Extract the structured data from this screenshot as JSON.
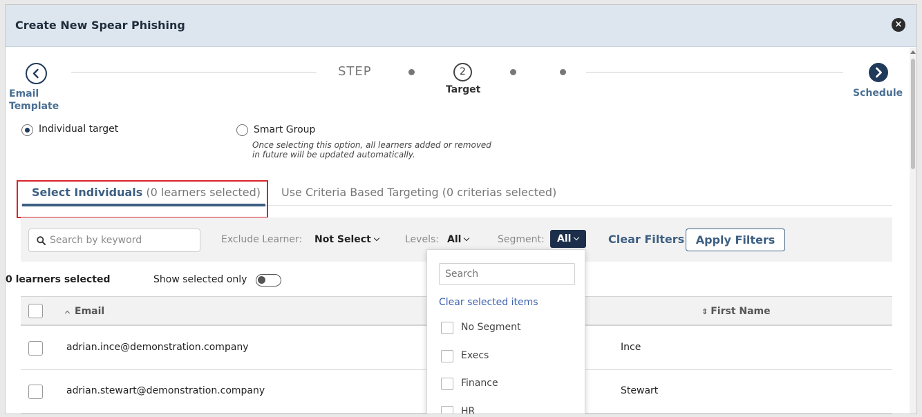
{
  "modal": {
    "title": "Create New Spear Phishing",
    "close_glyph": "×"
  },
  "stepper": {
    "prev_label": "Email Template",
    "step_word": "STEP",
    "current_number": "2",
    "current_label": "Target",
    "next_label": "Schedule"
  },
  "target_options": {
    "individual": {
      "label": "Individual target",
      "checked": true
    },
    "smart_group": {
      "label": "Smart Group",
      "checked": false,
      "help": "Once selecting this option, all learners added or removed in future will be updated automatically."
    }
  },
  "tabs": {
    "select_individuals": {
      "name": "Select Individuals",
      "count": "(0 learners selected)"
    },
    "criteria": {
      "label": "Use Criteria Based Targeting (0 criterias selected)"
    }
  },
  "filters": {
    "search_placeholder": "Search by keyword",
    "exclude_label": "Exclude Learner:",
    "exclude_value": "Not Select",
    "levels_label": "Levels:",
    "levels_value": "All",
    "segment_label": "Segment:",
    "segment_value": "All",
    "clear_label": "Clear Filters",
    "apply_label": "Apply Filters"
  },
  "selection": {
    "count_label": "0 learners selected",
    "show_selected_label": "Show selected only",
    "show_selected_on": false
  },
  "table": {
    "columns": {
      "email": "Email",
      "first_name": "First Name"
    },
    "rows": [
      {
        "email": "adrian.ince@demonstration.company",
        "last": "Ince"
      },
      {
        "email": "adrian.stewart@demonstration.company",
        "last": "Stewart"
      }
    ]
  },
  "segment_dropdown": {
    "search_placeholder": "Search",
    "clear_label": "Clear selected items",
    "items": [
      "No Segment",
      "Execs",
      "Finance",
      "HR"
    ]
  },
  "colors": {
    "primary": "#1f3a5a",
    "accent_text": "#3d5f82",
    "highlight_border": "#d8232a",
    "header_bg": "#dde6ee"
  }
}
